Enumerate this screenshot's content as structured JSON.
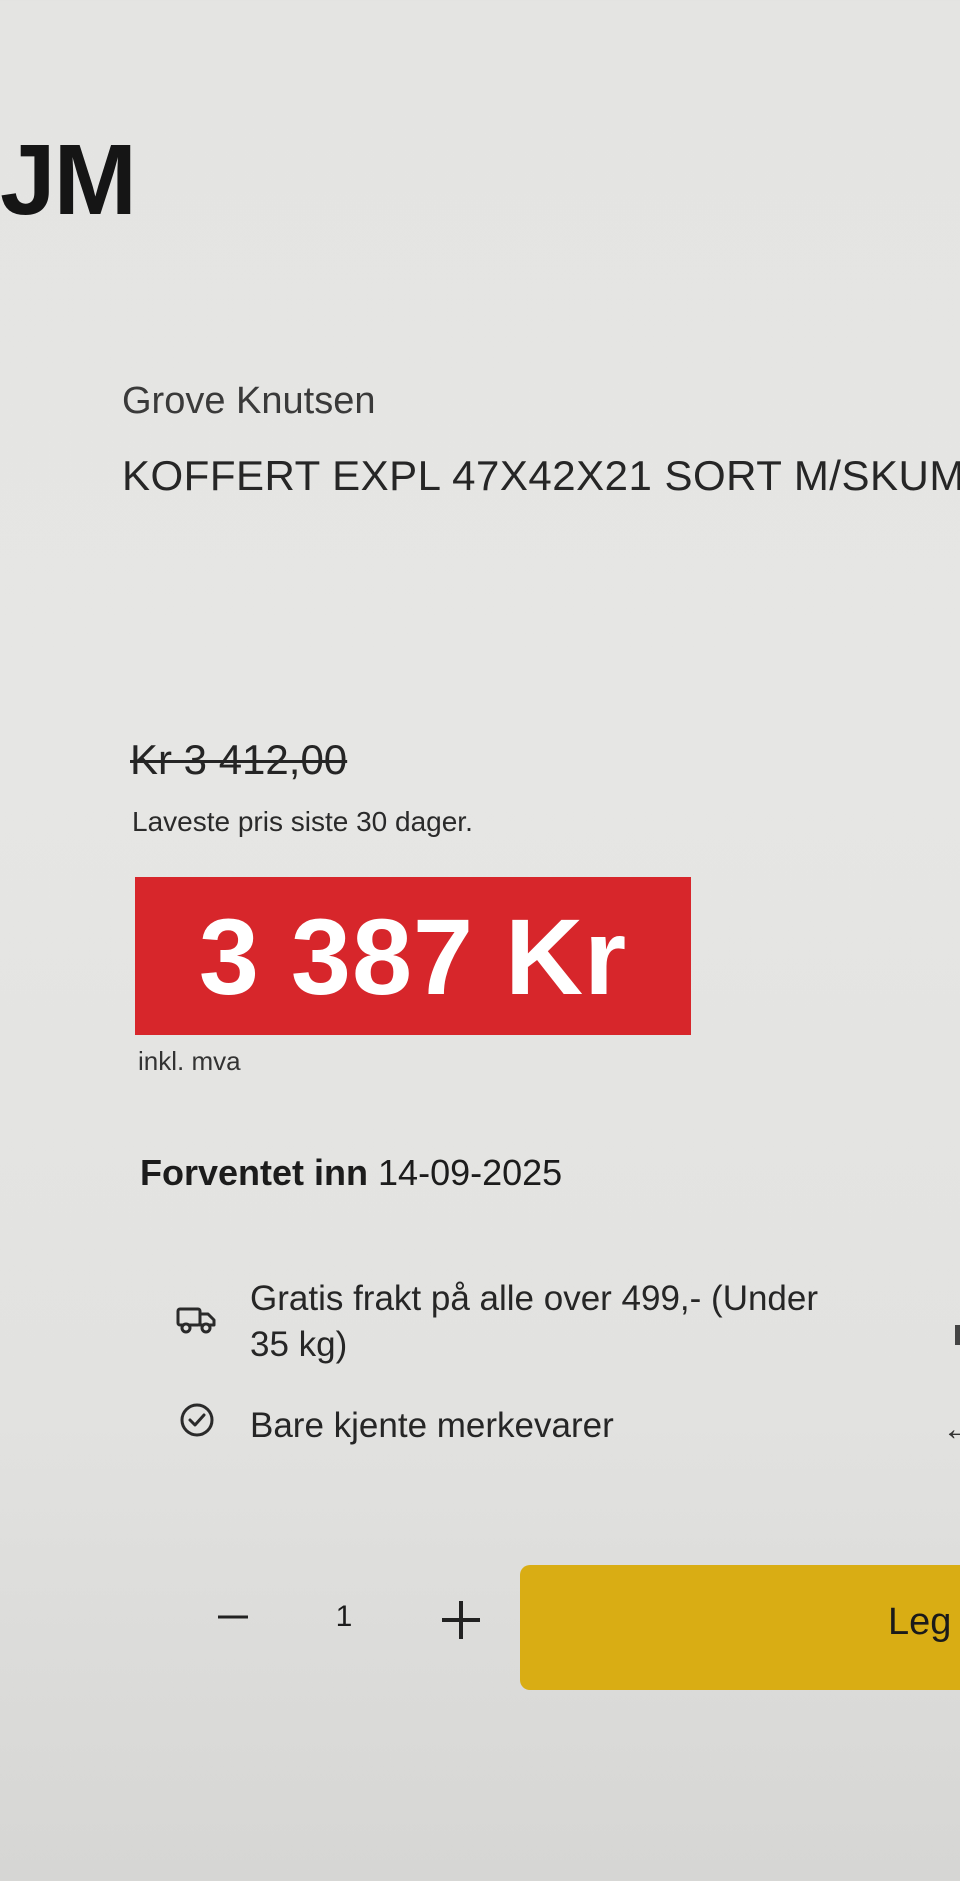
{
  "header": {
    "logo_fragment": "JM"
  },
  "product": {
    "brand": "Grove Knutsen",
    "title": "KOFFERT EXPL 47X42X21 SORT M/SKUM"
  },
  "pricing": {
    "old_price": "Kr 3 412,00",
    "lowest_note": "Laveste pris siste 30 dager.",
    "current_price": "3 387 Kr",
    "vat_note": "inkl. mva",
    "price_box_color": "#d7262b"
  },
  "availability": {
    "label": "Forventet inn",
    "date": "14-09-2025"
  },
  "perks": [
    {
      "icon": "truck-icon",
      "line1": "Gratis frakt på alle over 499,- (Under",
      "line2": "35 kg)"
    },
    {
      "icon": "check-circle-icon",
      "line1": "Bare kjente merkevarer"
    }
  ],
  "quantity": {
    "value": "1",
    "minus": "−",
    "plus": "+"
  },
  "cart": {
    "label": "Leg",
    "color": "#d9ad14"
  }
}
